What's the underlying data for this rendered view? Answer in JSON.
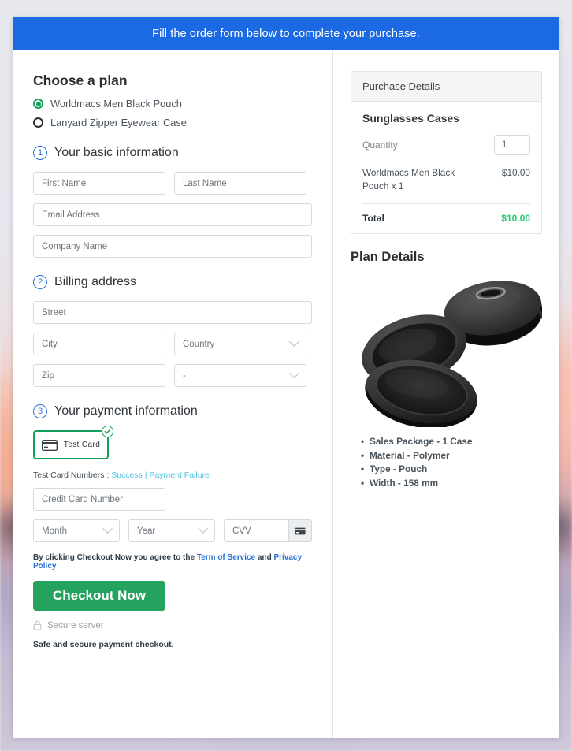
{
  "banner": {
    "message": "Fill the order form below to complete your purchase."
  },
  "plan": {
    "heading": "Choose a plan",
    "options": [
      {
        "label": "Worldmacs Men Black Pouch",
        "selected": true
      },
      {
        "label": "Lanyard Zipper Eyewear Case",
        "selected": false
      }
    ]
  },
  "steps": {
    "basic": {
      "number": "1",
      "title": "Your basic information"
    },
    "billing": {
      "number": "2",
      "title": "Billing address"
    },
    "payment": {
      "number": "3",
      "title": "Your payment information"
    }
  },
  "basic_fields": {
    "first_name": "First Name",
    "last_name": "Last Name",
    "email": "Email Address",
    "company": "Company Name"
  },
  "billing_fields": {
    "street": "Street",
    "city": "City",
    "country": "Country",
    "zip": "Zip",
    "state": "-"
  },
  "payment": {
    "tile_label": "Test Card",
    "tile_icon": "credit-card-icon",
    "tile_badge_icon": "check-circle-icon",
    "test_numbers_prefix": "Test Card Numbers : ",
    "success_link": "Success",
    "separator": " | ",
    "failure_link": "Payment Failure",
    "card_number": "Credit Card Number",
    "month": "Month",
    "year": "Year",
    "cvv": "CVV",
    "cvv_icon": "card-cvv-icon"
  },
  "footer": {
    "terms_prefix": "By clicking Checkout Now you agree to the ",
    "terms_link": "Term of Service",
    "terms_and": " and ",
    "privacy_link": "Privacy Policy",
    "checkout_label": "Checkout Now",
    "secure_icon": "lock-icon",
    "secure_text": "Secure server",
    "safe_note": "Safe and secure payment checkout."
  },
  "purchase": {
    "header": "Purchase Details",
    "product_title": "Sunglasses Cases",
    "quantity_label": "Quantity",
    "quantity_value": "1",
    "line_item": "Worldmacs Men Black Pouch x 1",
    "line_amount": "$10.00",
    "total_label": "Total",
    "total_amount": "$10.00",
    "total_color": "#2ecc71"
  },
  "plan_details": {
    "title": "Plan Details",
    "image_alt": "sunglasses-case-product-photo",
    "specs": [
      "Sales Package - 1 Case",
      "Material - Polymer",
      "Type - Pouch",
      "Width - 158 mm"
    ]
  },
  "colors": {
    "banner_blue": "#1b6ae4",
    "accent_green": "#12a05a",
    "checkout_green": "#23a35d",
    "link_blue": "#2a6fd6",
    "test_link_cyan": "#4ec3e0"
  }
}
